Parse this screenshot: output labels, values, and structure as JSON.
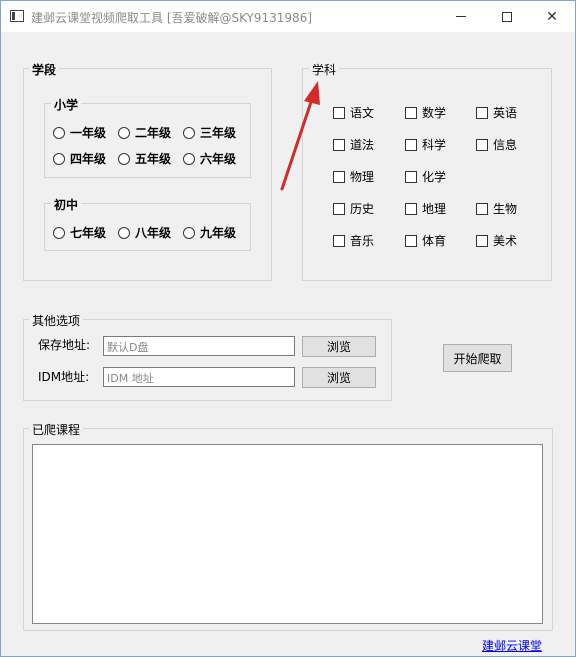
{
  "window": {
    "title": "建邺云课堂视频爬取工具 [吾爱破解@SKY9131986]",
    "icon": "app-window-icon"
  },
  "stage": {
    "title": "学段",
    "primary": {
      "title": "小学",
      "options": [
        "一年级",
        "二年级",
        "三年级",
        "四年级",
        "五年级",
        "六年级"
      ]
    },
    "middle": {
      "title": "初中",
      "options": [
        "七年级",
        "八年级",
        "九年级"
      ]
    }
  },
  "subject": {
    "title": "学科",
    "options": [
      "语文",
      "数学",
      "英语",
      "道法",
      "科学",
      "信息",
      "物理",
      "化学",
      "历史",
      "地理",
      "生物",
      "音乐",
      "体育",
      "美术"
    ]
  },
  "other": {
    "title": "其他选项",
    "save_label": "保存地址:",
    "save_placeholder": "默认D盘",
    "idm_label": "IDM地址:",
    "idm_placeholder": "IDM 地址",
    "browse1": "浏览",
    "browse2": "浏览"
  },
  "start_button": "开始爬取",
  "courses": {
    "title": "已爬课程"
  },
  "footer_link": "建邺云课堂",
  "colors": {
    "annotation_arrow": "#d42a2a",
    "link": "#0000ee"
  }
}
